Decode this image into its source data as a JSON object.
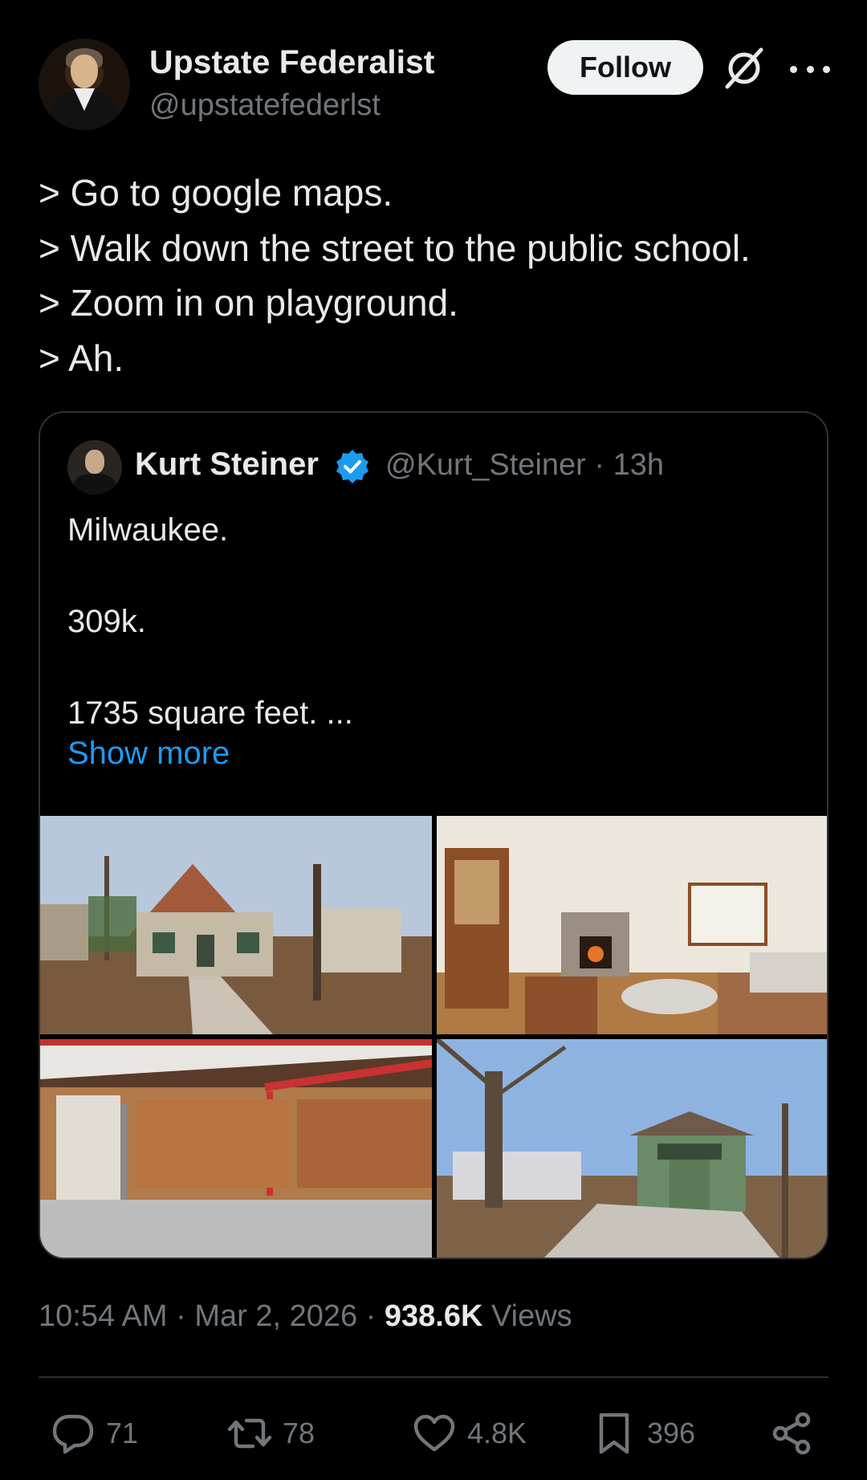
{
  "author": {
    "display_name": "Upstate Federalist",
    "handle": "@upstatefederlst",
    "follow_label": "Follow"
  },
  "post": {
    "lines": [
      "> Go to google maps.",
      "> Walk down the street to the public school.",
      "> Zoom in on playground.",
      "> Ah."
    ]
  },
  "quoted": {
    "display_name": "Kurt Steiner",
    "handle_time": "@Kurt_Steiner · 13h",
    "lines": [
      "Milwaukee.",
      "",
      "309k.",
      "",
      "1735 square feet. ..."
    ],
    "show_more": "Show more"
  },
  "meta": {
    "time_date": "10:54 AM · Mar 2, 2026 · ",
    "views_count": "938.6K",
    "views_label": " Views"
  },
  "actions": {
    "replies": "71",
    "reposts": "78",
    "likes": "4.8K",
    "bookmarks": "396"
  },
  "colors": {
    "background": "#000000",
    "text": "#e7e9ea",
    "secondary": "#71767b",
    "link": "#1d9bf0",
    "border": "#2f3336"
  },
  "icons": [
    "grok-icon",
    "more-icon",
    "verified-icon",
    "reply-icon",
    "repost-icon",
    "like-icon",
    "bookmark-icon",
    "share-icon"
  ]
}
